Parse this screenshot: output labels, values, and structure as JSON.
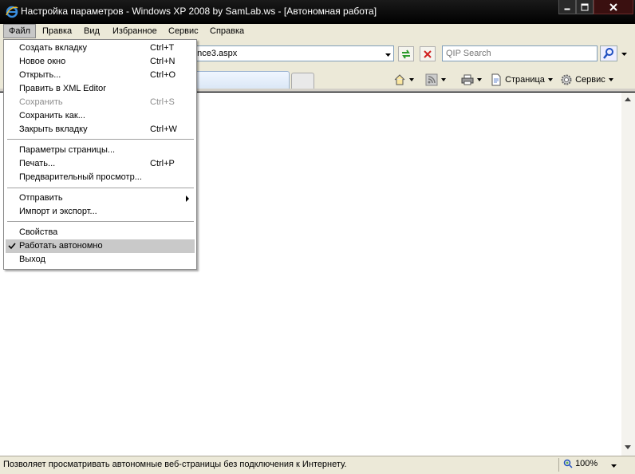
{
  "window": {
    "title": "Настройка параметров - Windows XP 2008 by SamLab.ws - [Автономная работа]"
  },
  "menubar": {
    "items": [
      "Файл",
      "Правка",
      "Вид",
      "Избранное",
      "Сервис",
      "Справка"
    ]
  },
  "address_bar": {
    "value": "once3.aspx"
  },
  "search": {
    "placeholder": "QIP Search"
  },
  "command_bar": {
    "page_label": "Страница",
    "tools_label": "Сервис"
  },
  "file_menu": {
    "items": [
      {
        "label": "Создать вкладку",
        "shortcut": "Ctrl+T"
      },
      {
        "label": "Новое окно",
        "shortcut": "Ctrl+N"
      },
      {
        "label": "Открыть...",
        "shortcut": "Ctrl+O"
      },
      {
        "label": "Править в XML Editor",
        "shortcut": ""
      },
      {
        "label": "Сохранить",
        "shortcut": "Ctrl+S"
      },
      {
        "label": "Сохранить как...",
        "shortcut": ""
      },
      {
        "label": "Закрыть вкладку",
        "shortcut": "Ctrl+W"
      },
      {
        "label": "Параметры страницы...",
        "shortcut": ""
      },
      {
        "label": "Печать...",
        "shortcut": "Ctrl+P"
      },
      {
        "label": "Предварительный просмотр...",
        "shortcut": ""
      },
      {
        "label": "Отправить",
        "shortcut": ""
      },
      {
        "label": "Импорт и экспорт...",
        "shortcut": ""
      },
      {
        "label": "Свойства",
        "shortcut": ""
      },
      {
        "label": "Работать автономно",
        "shortcut": ""
      },
      {
        "label": "Выход",
        "shortcut": ""
      }
    ]
  },
  "status_bar": {
    "text": "Позволяет просматривать автономные веб-страницы без подключения к Интернету.",
    "zoom": "100%"
  }
}
